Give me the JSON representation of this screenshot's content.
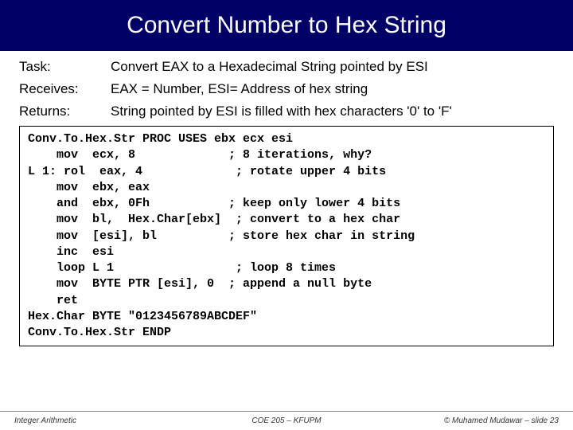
{
  "title": "Convert Number to Hex String",
  "task": {
    "label": "Task:",
    "value": "Convert EAX to a Hexadecimal String pointed by ESI"
  },
  "receives": {
    "label": "Receives:",
    "value": "EAX = Number, ESI= Address of hex string"
  },
  "returns": {
    "label": "Returns:",
    "value": "String pointed by ESI is filled with hex characters '0' to 'F'"
  },
  "code": "Conv.To.Hex.Str PROC USES ebx ecx esi\n    mov  ecx, 8             ; 8 iterations, why?\nL 1: rol  eax, 4             ; rotate upper 4 bits\n    mov  ebx, eax\n    and  ebx, 0Fh           ; keep only lower 4 bits\n    mov  bl,  Hex.Char[ebx]  ; convert to a hex char\n    mov  [esi], bl          ; store hex char in string\n    inc  esi\n    loop L 1                 ; loop 8 times\n    mov  BYTE PTR [esi], 0  ; append a null byte\n    ret\nHex.Char BYTE \"0123456789ABCDEF\"\nConv.To.Hex.Str ENDP",
  "footer": {
    "left": "Integer Arithmetic",
    "center": "COE 205 – KFUPM",
    "right": "© Muhamed Mudawar – slide 23"
  }
}
